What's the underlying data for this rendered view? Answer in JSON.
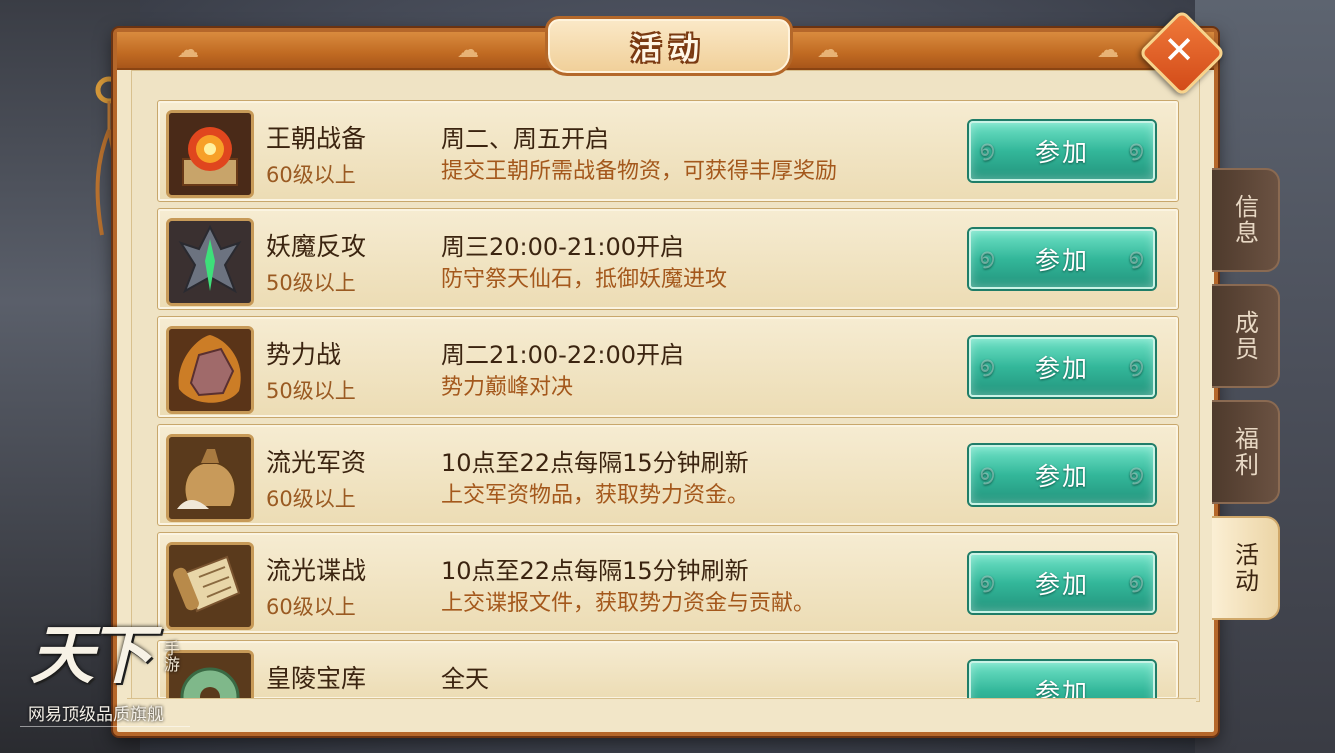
{
  "window": {
    "title": "活动",
    "close_icon": "close-icon"
  },
  "activities": [
    {
      "name": "王朝战备",
      "level": "60级以上",
      "time": "周二、周五开启",
      "desc": "提交王朝所需战备物资，可获得丰厚奖励",
      "button": "参加",
      "icon": "fire-orb-icon"
    },
    {
      "name": "妖魔反攻",
      "level": "50级以上",
      "time": "周三20:00-21:00开启",
      "desc": "防守祭天仙石，抵御妖魔进攻",
      "button": "参加",
      "icon": "demon-totem-icon"
    },
    {
      "name": "势力战",
      "level": "50级以上",
      "time": "周二21:00-22:00开启",
      "desc": "势力巅峰对决",
      "button": "参加",
      "icon": "flaming-stone-icon"
    },
    {
      "name": "流光军资",
      "level": "60级以上",
      "time": "10点至22点每隔15分钟刷新",
      "desc": "上交军资物品，获取势力资金。",
      "button": "参加",
      "icon": "supply-sack-icon"
    },
    {
      "name": "流光谍战",
      "level": "60级以上",
      "time": "10点至22点每隔15分钟刷新",
      "desc": "上交谍报文件，获取势力资金与贡献。",
      "button": "参加",
      "icon": "scroll-icon"
    },
    {
      "name": "皇陵宝库",
      "level": "",
      "time": "全天",
      "desc": "",
      "button": "参加",
      "icon": "jade-disc-icon"
    }
  ],
  "tabs": [
    {
      "label": "信息",
      "active": false
    },
    {
      "label": "成员",
      "active": false
    },
    {
      "label": "福利",
      "active": false
    },
    {
      "label": "活动",
      "active": true
    }
  ],
  "branding": {
    "logo": "天下",
    "logo_sub": "手游",
    "tagline": "网易顶级品质旗舰"
  },
  "colors": {
    "accent_button": "#33b79a",
    "frame": "#b5672a",
    "level_text": "#9a5a22"
  }
}
